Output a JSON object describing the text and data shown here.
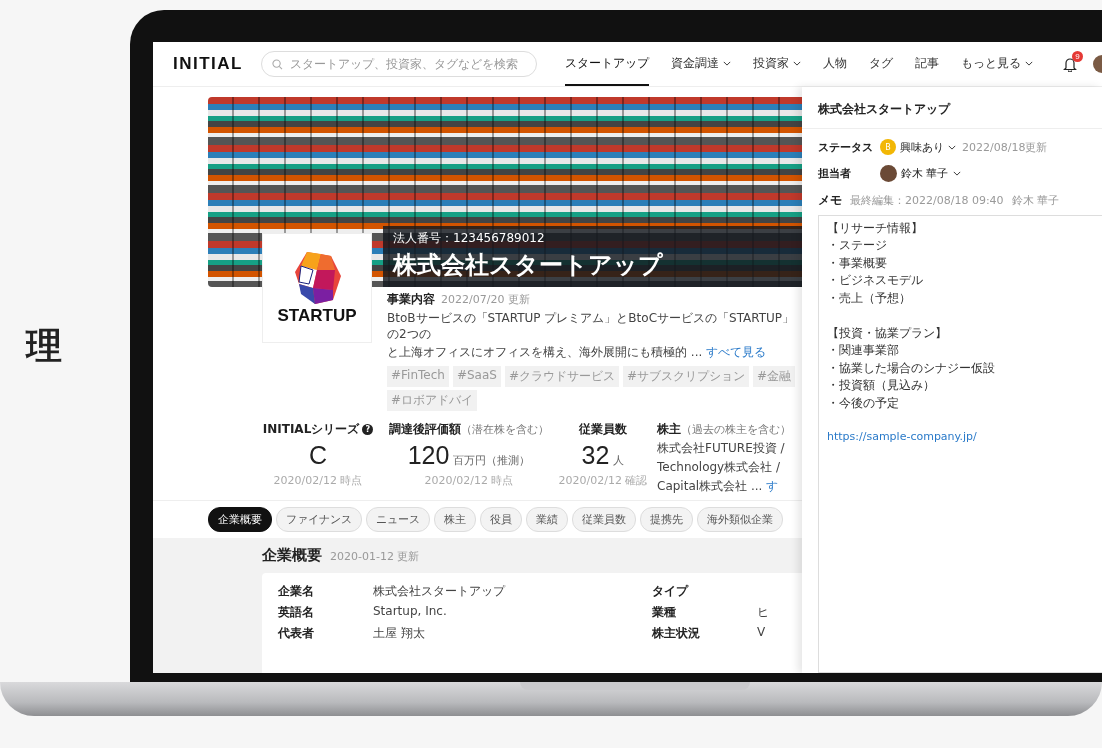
{
  "side_text": "理",
  "header": {
    "logo": "INITIAL",
    "search": {
      "placeholder": "スタートアップ、投資家、タグなどを検索"
    },
    "nav": [
      {
        "label": "スタートアップ",
        "selected": true,
        "dropdown": false
      },
      {
        "label": "資金調達",
        "selected": false,
        "dropdown": true
      },
      {
        "label": "投資家",
        "selected": false,
        "dropdown": true
      },
      {
        "label": "人物",
        "selected": false,
        "dropdown": false
      },
      {
        "label": "タグ",
        "selected": false,
        "dropdown": false
      },
      {
        "label": "記事",
        "selected": false,
        "dropdown": false
      },
      {
        "label": "もっと見る",
        "selected": false,
        "dropdown": true
      }
    ],
    "notifications": "9"
  },
  "company": {
    "corporate_number": "法人番号：123456789012",
    "name": "株式会社スタートアップ",
    "logo_text": "STARTUP",
    "business_label": "事業内容",
    "business_updated": "2022/07/20 更新",
    "description_lines": [
      "BtoBサービスの「STARTUP プレミアム」とBtoCサービスの「STARTUP」の2つの",
      "と上海オフィスにオフィスを構え、海外展開にも積極的 ..."
    ],
    "description_link": "すべて見る",
    "tags": [
      "#FinTech",
      "#SaaS",
      "#クラウドサービス",
      "#サブスクリプション",
      "#金融",
      "#ロボアドバイ"
    ]
  },
  "stats": [
    {
      "label": "INITIALシリーズ",
      "help": "?",
      "value": "C",
      "date": "2020/02/12 時点"
    },
    {
      "label": "調達後評価額",
      "note": "（潜在株を含む）",
      "value": "120",
      "unit": "百万円（推測）",
      "date": "2020/02/12 時点"
    },
    {
      "label": "従業員数",
      "value": "32",
      "unit": "人",
      "date": "2020/02/12 確認"
    }
  ],
  "shareholders": {
    "label": "株主",
    "note": "（過去の株主を含む）",
    "lines": [
      "株式会社FUTURE投資 /",
      "Technology株式会社 /",
      "Capital株式会社 ..."
    ],
    "link": "す"
  },
  "tabs": [
    {
      "label": "企業概要",
      "selected": true
    },
    {
      "label": "ファイナンス",
      "selected": false
    },
    {
      "label": "ニュース",
      "selected": false
    },
    {
      "label": "株主",
      "selected": false
    },
    {
      "label": "役員",
      "selected": false
    },
    {
      "label": "業績",
      "selected": false
    },
    {
      "label": "従業員数",
      "selected": false
    },
    {
      "label": "提携先",
      "selected": false
    },
    {
      "label": "海外類似企業",
      "selected": false
    }
  ],
  "overview": {
    "title": "企業概要",
    "updated": "2020-01-12 更新",
    "rows_left": [
      {
        "label": "企業名",
        "value": "株式会社スタートアップ"
      },
      {
        "label": "英語名",
        "value": "Startup, Inc."
      },
      {
        "label": "代表者",
        "value": "土屋 翔太"
      }
    ],
    "rows_right": [
      {
        "label": "タイプ"
      },
      {
        "label": "業種",
        "value": "ヒ"
      },
      {
        "label": "株主状況",
        "value": "V"
      }
    ]
  },
  "panel": {
    "title": "株式会社スタートアップ",
    "status": {
      "label": "ステータス",
      "badge": "B",
      "color": "#f2b705",
      "value": "興味あり",
      "updated": "2022/08/18更新"
    },
    "assignee": {
      "label": "担当者",
      "value": "鈴木 華子"
    },
    "memo": {
      "label": "メモ",
      "edited": "最終編集：2022/08/18 09:40",
      "editor": "鈴木 華子",
      "sections": [
        [
          "【リサーチ情報】",
          "・ステージ",
          "・事業概要",
          "・ビジネスモデル",
          "・売上（予想）"
        ],
        [
          "【投資・協業プラン】",
          "・関連事業部",
          "・協業した場合のシナジー仮設",
          "・投資額（見込み）",
          "・今後の予定"
        ]
      ],
      "link": "https://sample-company.jp/"
    }
  }
}
